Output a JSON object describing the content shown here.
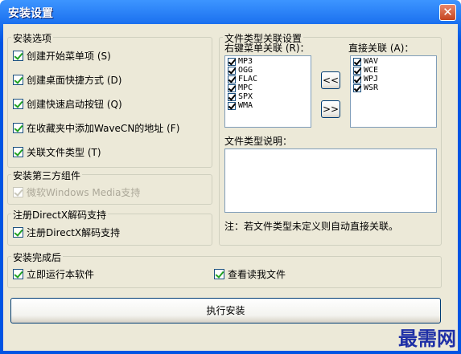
{
  "window": {
    "title": "安装设置",
    "close_symbol": "✕"
  },
  "install_options": {
    "legend": "安装选项",
    "items": [
      {
        "label": "创建开始菜单项 (S)",
        "checked": true
      },
      {
        "label": "创建桌面快捷方式 (D)",
        "checked": true
      },
      {
        "label": "创建快速启动按钮 (Q)",
        "checked": true
      },
      {
        "label": "在收藏夹中添加WaveCN的地址 (F)",
        "checked": true
      },
      {
        "label": "关联文件类型 (T)",
        "checked": true
      }
    ]
  },
  "third_party": {
    "legend": "安装第三方组件",
    "item": {
      "label": "微软Windows Media支持",
      "checked": true,
      "disabled": true
    }
  },
  "directx": {
    "legend": "注册DirectX解码支持",
    "item": {
      "label": "注册DirectX解码支持",
      "checked": true
    }
  },
  "file_assoc": {
    "legend": "文件类型关联设置",
    "right_menu_label": "右键菜单关联 (R)：",
    "direct_label": "直接关联 (A)：",
    "right_menu_items": [
      "MP3",
      "OGG",
      "FLAC",
      "MPC",
      "SPX",
      "WMA"
    ],
    "direct_items": [
      "WAV",
      "WCE",
      "WPJ",
      "WSR"
    ],
    "move_left_label": "<<",
    "move_right_label": ">>",
    "desc_label": "文件类型说明：",
    "desc_text": "",
    "note": "注：若文件类型未定义则自动直接关联。"
  },
  "after_install": {
    "legend": "安装完成后",
    "run_label": "立即运行本软件",
    "readme_label": "查看读我文件"
  },
  "execute_button": "执行安装",
  "watermark": "最需网"
}
